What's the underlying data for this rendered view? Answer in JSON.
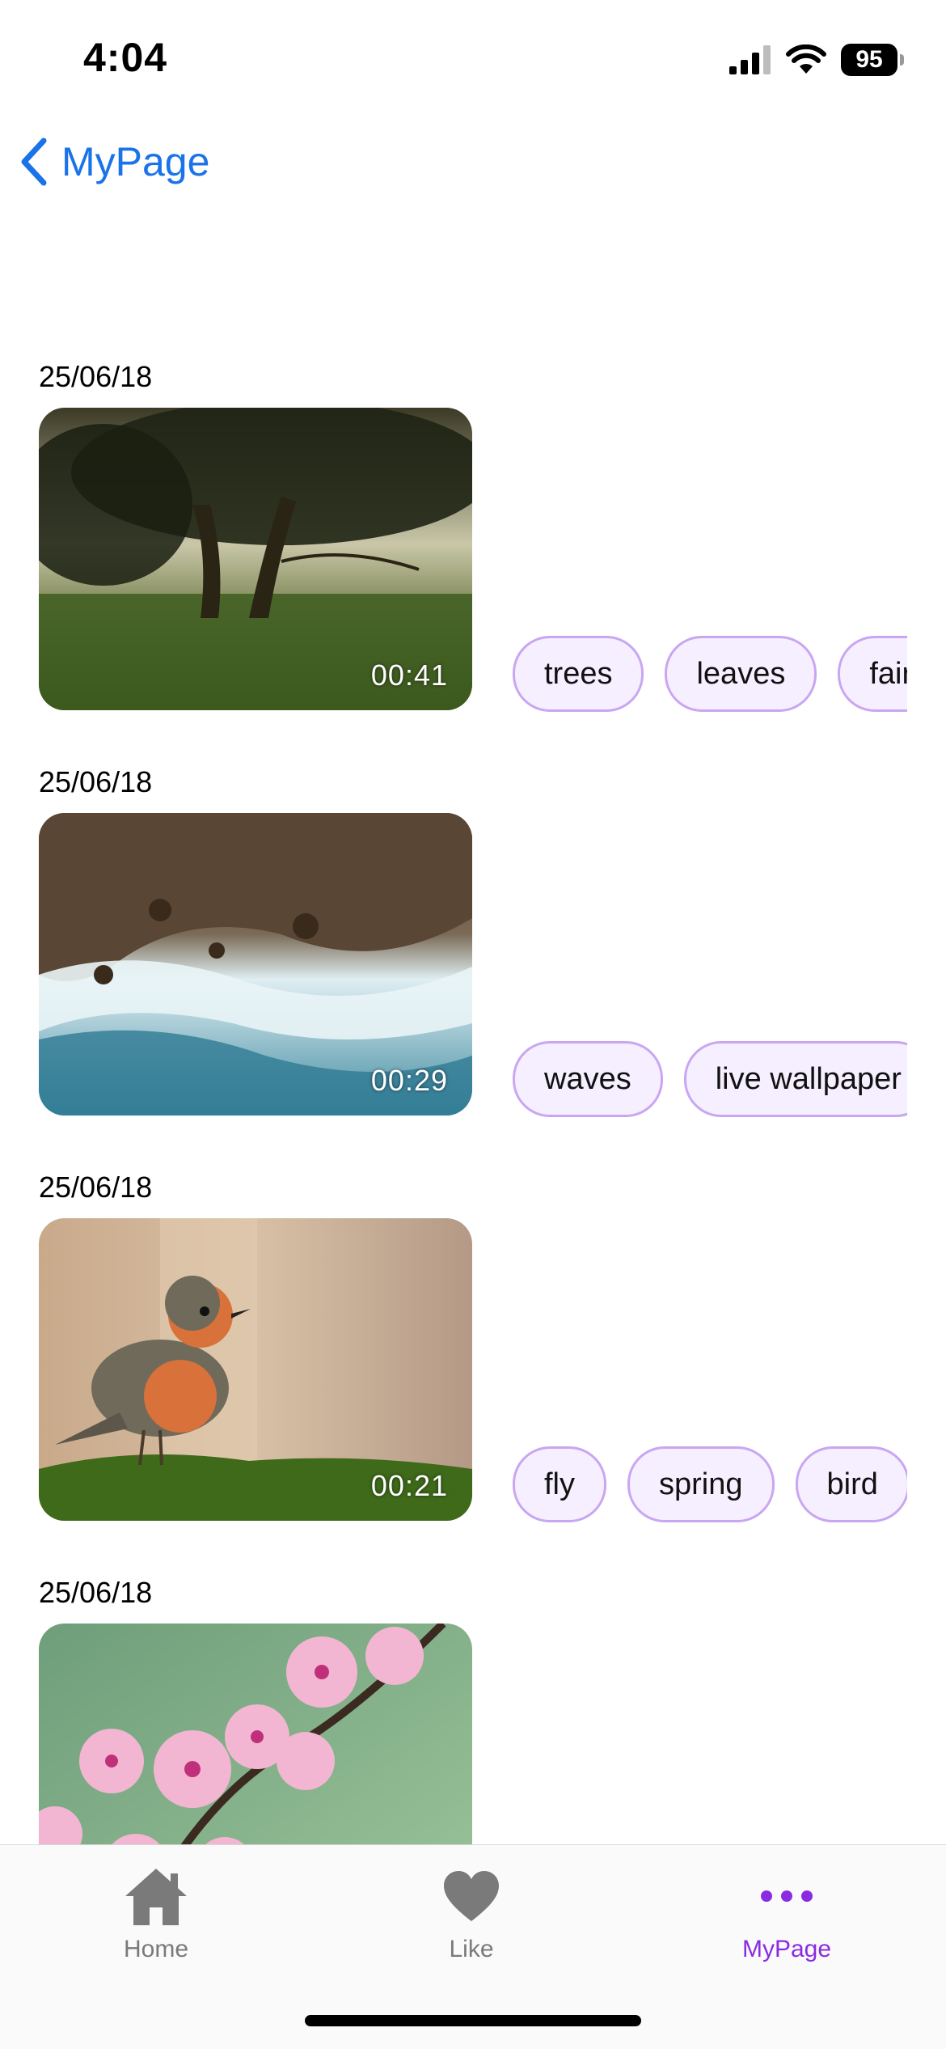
{
  "status": {
    "time": "4:04",
    "battery": "95"
  },
  "nav": {
    "back_label": "MyPage"
  },
  "entries": [
    {
      "date": "25/06/18",
      "duration": "00:41",
      "image": "misty-forest-trees",
      "tags": [
        "trees",
        "leaves",
        "fair"
      ]
    },
    {
      "date": "25/06/18",
      "duration": "00:29",
      "image": "aerial-waves-rocks",
      "tags": [
        "waves",
        "live wallpaper"
      ]
    },
    {
      "date": "25/06/18",
      "duration": "00:21",
      "image": "robin-bird-on-moss",
      "tags": [
        "fly",
        "spring",
        "bird"
      ]
    },
    {
      "date": "25/06/18",
      "duration": "",
      "image": "pink-cherry-blossoms",
      "tags": [
        "",
        ""
      ]
    }
  ],
  "tabbar": {
    "items": [
      {
        "label": "Home",
        "icon": "home-icon"
      },
      {
        "label": "Like",
        "icon": "heart-icon"
      },
      {
        "label": "MyPage",
        "icon": "more-dots-icon"
      }
    ],
    "active_color": "#8a2be2",
    "inactive_color": "#7a7a7a"
  },
  "colors": {
    "accent": "#1a73e8",
    "tag_border": "#c9a6f2",
    "tag_bg": "#f6efff"
  }
}
